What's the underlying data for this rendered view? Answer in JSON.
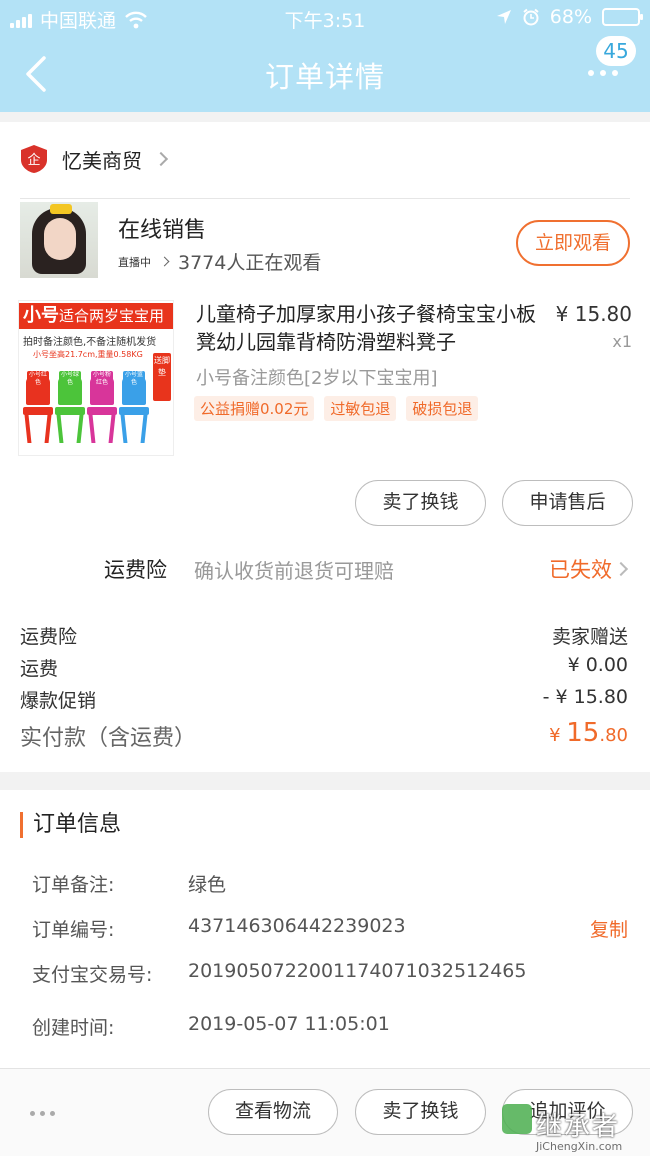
{
  "status_bar": {
    "carrier": "中国联通",
    "time": "下午3:51",
    "battery": "68%",
    "battery_color": "#f5c518"
  },
  "nav": {
    "title": "订单详情",
    "badge": "45",
    "back_icon": "chevron-left-icon",
    "more_icon": "more-dots-icon"
  },
  "shop": {
    "name": "忆美商贸",
    "logo": "企"
  },
  "live": {
    "name": "在线销售",
    "tag": "直播中",
    "viewers": "3774人正在观看",
    "watch_label": "立即观看"
  },
  "product": {
    "title": "儿童椅子加厚家用小孩子餐椅宝宝小板凳幼儿园靠背椅防滑塑料凳子",
    "price": "¥ 15.80",
    "qty": "x1",
    "spec": "小号备注颜色[2岁以下宝宝用]",
    "tags": [
      "公益捐赠0.02元",
      "过敏包退",
      "破损包退"
    ],
    "thumb": {
      "banner_main": "小号",
      "banner_sub": "适合两岁宝宝用",
      "line2": "拍时备注颜色,不备注随机发货",
      "line3": "小号坐高21.7cm,重量0.58KG",
      "side": "送脚垫",
      "chairs": [
        {
          "label": "小号红色",
          "color": "#e8321f"
        },
        {
          "label": "小号绿色",
          "color": "#4cc43a"
        },
        {
          "label": "小号粉红色",
          "color": "#d8359a"
        },
        {
          "label": "小号蓝色",
          "color": "#3aa0e8"
        }
      ]
    }
  },
  "actions": {
    "sell": "卖了换钱",
    "aftersale": "申请售后"
  },
  "insurance": {
    "label": "运费险",
    "desc": "确认收货前退货可理赔",
    "status": "已失效"
  },
  "fees": [
    {
      "label": "运费险",
      "value": "卖家赠送"
    },
    {
      "label": "运费",
      "value": "¥ 0.00"
    },
    {
      "label": "爆款促销",
      "value": "- ¥ 15.80"
    }
  ],
  "total": {
    "label": "实付款（含运费）",
    "currency": "¥ ",
    "int": "15",
    "dec": ".80"
  },
  "order_info": {
    "title": "订单信息",
    "rows": [
      {
        "label": "订单备注:",
        "value": "绿色"
      },
      {
        "label": "订单编号:",
        "value": "437146306442239023",
        "action": "复制"
      },
      {
        "label": "支付宝交易号:",
        "value": "2019050722001174071032512465"
      },
      {
        "label": "创建时间:",
        "value": "2019-05-07 11:05:01"
      }
    ]
  },
  "bottom": {
    "logistics": "查看物流",
    "sell": "卖了换钱",
    "review": "追加评价"
  },
  "watermark": {
    "text": "继承者",
    "url": "JiChengXin.com"
  },
  "colors": {
    "header_bg": "#b3e2f6",
    "accent": "#f06a2a"
  }
}
